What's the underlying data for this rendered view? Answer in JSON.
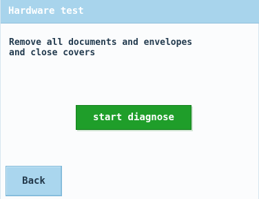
{
  "window": {
    "title": "Hardware test"
  },
  "main": {
    "message": "Remove all documents and envelopes\nand close covers",
    "start_button_label": "start diagnose"
  },
  "footer": {
    "back_label": "Back"
  },
  "colors": {
    "title_bar": "#a8d4ec",
    "start_button": "#1f9e2a",
    "back_button": "#aad6ee",
    "text": "#223a4e"
  }
}
